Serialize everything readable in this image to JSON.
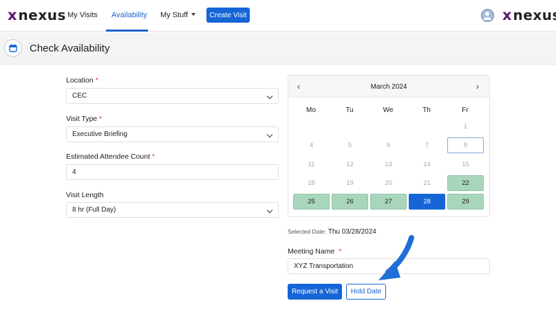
{
  "brand": {
    "name": "nexus",
    "mark": "x"
  },
  "nav": {
    "items": [
      {
        "label": "My Visits"
      },
      {
        "label": "Availability"
      },
      {
        "label": "My Stuff"
      }
    ],
    "create_label": "Create Visit"
  },
  "header": {
    "title": "Check Availability",
    "icon": "calendar-icon"
  },
  "form": {
    "location": {
      "label": "Location",
      "value": "CEC"
    },
    "visit_type": {
      "label": "Visit Type",
      "value": "Executive Briefing"
    },
    "attendees": {
      "label": "Estimated Attendee Count",
      "value": "4"
    },
    "visit_length": {
      "label": "Visit Length",
      "value": "8 hr (Full Day)"
    },
    "required_mark": "*"
  },
  "calendar": {
    "title": "March 2024",
    "prev": "‹",
    "next": "›",
    "weekdays": [
      "Mo",
      "Tu",
      "We",
      "Th",
      "Fr"
    ],
    "days": [
      {
        "n": "1",
        "state": "disabled"
      },
      {
        "n": "4",
        "state": "disabled"
      },
      {
        "n": "5",
        "state": "disabled"
      },
      {
        "n": "6",
        "state": "disabled"
      },
      {
        "n": "7",
        "state": "disabled"
      },
      {
        "n": "8",
        "state": "today"
      },
      {
        "n": "11",
        "state": "disabled"
      },
      {
        "n": "12",
        "state": "disabled"
      },
      {
        "n": "13",
        "state": "disabled"
      },
      {
        "n": "14",
        "state": "disabled"
      },
      {
        "n": "15",
        "state": "disabled"
      },
      {
        "n": "18",
        "state": "disabled"
      },
      {
        "n": "19",
        "state": "disabled"
      },
      {
        "n": "20",
        "state": "disabled"
      },
      {
        "n": "21",
        "state": "disabled"
      },
      {
        "n": "22",
        "state": "available"
      },
      {
        "n": "25",
        "state": "available"
      },
      {
        "n": "26",
        "state": "available"
      },
      {
        "n": "27",
        "state": "available"
      },
      {
        "n": "28",
        "state": "selected"
      },
      {
        "n": "29",
        "state": "available"
      }
    ]
  },
  "selection": {
    "label": "Selected Date:",
    "value": "Thu 03/28/2024"
  },
  "meeting": {
    "label": "Meeting Name",
    "required_mark": "*",
    "value": "XYZ Transportation"
  },
  "actions": {
    "request_label": "Request a Visit",
    "hold_label": "Hold Date"
  },
  "colors": {
    "primary": "#1565d6",
    "brand": "#5b1870",
    "available": "#a8d6bc",
    "annotation_arrow": "#1f6fd6"
  }
}
